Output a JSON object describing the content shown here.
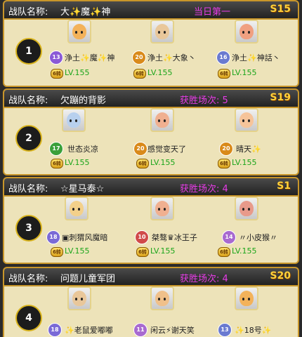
{
  "label": "战队名称:",
  "teams": [
    {
      "rank": "1",
      "name": "大✨魔✨神",
      "status": "当日第一",
      "server": "S15",
      "members": [
        {
          "badge": "13",
          "name": "浄土✨魔✨神",
          "lv_badge": "6转",
          "lv": "LV.155"
        },
        {
          "badge": "20",
          "name": "浄土✨大象丶",
          "lv_badge": "6转",
          "lv": "LV.155"
        },
        {
          "badge": "16",
          "name": "浄土✨神話丶",
          "lv_badge": "6转",
          "lv": "LV.155"
        }
      ]
    },
    {
      "rank": "2",
      "name": "欠蹦的背影",
      "status": "获胜场次: 5",
      "server": "S19",
      "members": [
        {
          "badge": "17",
          "name": "世态炎凉",
          "lv_badge": "6转",
          "lv": "LV.155"
        },
        {
          "badge": "20",
          "name": "感觉变天了",
          "lv_badge": "6转",
          "lv": "LV.155"
        },
        {
          "badge": "20",
          "name": "晴天✨",
          "lv_badge": "6转",
          "lv": "LV.155"
        }
      ]
    },
    {
      "rank": "3",
      "name": "☆星马泰☆",
      "status": "获胜场次: 4",
      "server": "S1",
      "members": [
        {
          "badge": "18",
          "name": "▣刺猬风魔暗",
          "lv_badge": "6转",
          "lv": "LV.155"
        },
        {
          "badge": "10",
          "name": "桀骜♛冰王子",
          "lv_badge": "6转",
          "lv": "LV.155"
        },
        {
          "badge": "14",
          "name": "〃小皮猴〃",
          "lv_badge": "6转",
          "lv": "LV.155"
        }
      ]
    },
    {
      "rank": "4",
      "name": "问题儿童军团",
      "status": "获胜场次: 4",
      "server": "S20",
      "members": [
        {
          "badge": "18",
          "name": "✨老鼠爱嘟嘟",
          "lv_badge": "",
          "lv": ""
        },
        {
          "badge": "11",
          "name": "闲云⚡谢天笑",
          "lv_badge": "",
          "lv": ""
        },
        {
          "badge": "13",
          "name": "✨18号✨",
          "lv_badge": "",
          "lv": ""
        }
      ]
    }
  ],
  "colors": {
    "card_bg": "#ede3b9",
    "border_gold": "#c8962a",
    "status_magenta": "#e63ce6",
    "server_gold": "#ffd23a",
    "level_green": "#1aa51a"
  }
}
